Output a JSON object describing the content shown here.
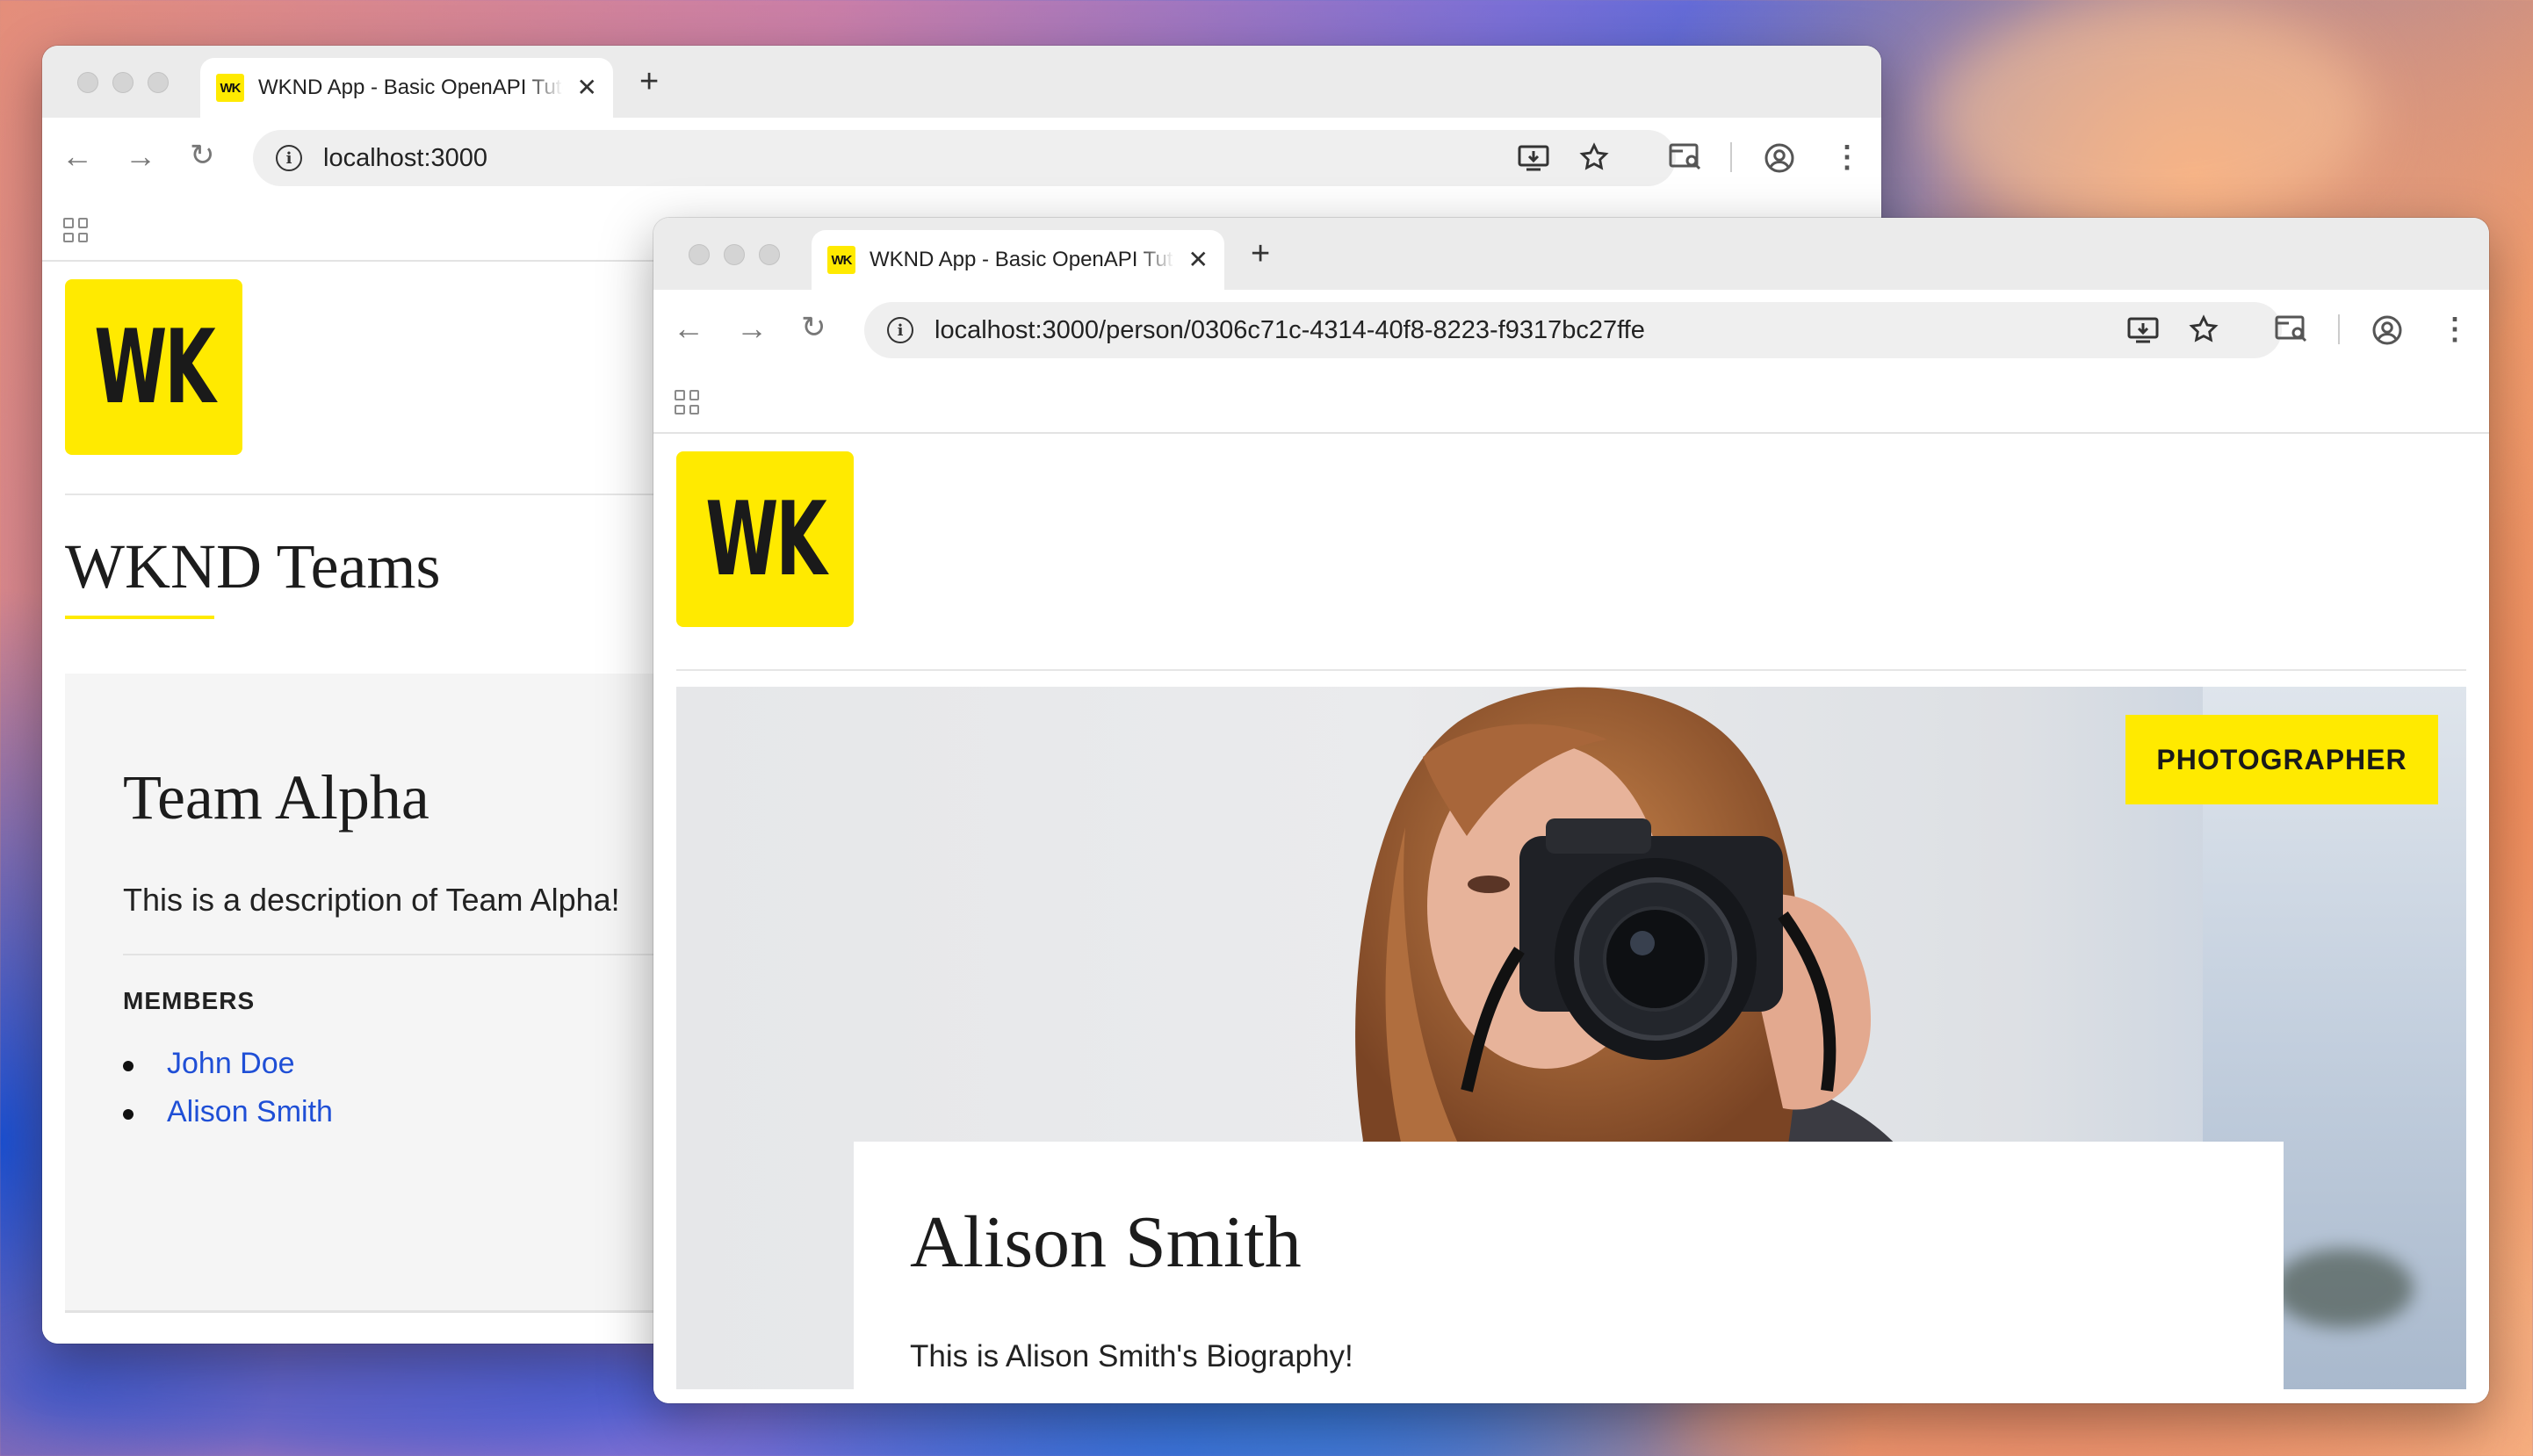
{
  "back_window": {
    "tab": {
      "favicon": "WK",
      "title": "WKND App - Basic OpenAPI Tutorial"
    },
    "url": "localhost:3000",
    "logo": "WK",
    "page_heading": "WKND Teams",
    "team": {
      "name": "Team Alpha",
      "description": "This is a description of Team Alpha!",
      "members_label": "MEMBERS",
      "members": [
        "John Doe",
        "Alison Smith"
      ]
    }
  },
  "front_window": {
    "tab": {
      "favicon": "WK",
      "title": "WKND App - Basic OpenAPI Tutorial"
    },
    "url": "localhost:3000/person/0306c71c-4314-40f8-8223-f9317bc27ffe",
    "logo": "WK",
    "occupation_badge": "PHOTOGRAPHER",
    "person": {
      "name": "Alison Smith",
      "biography": "This is Alison Smith's Biography!"
    }
  },
  "icons": {
    "back": "arrow-left-icon",
    "forward": "arrow-right-icon",
    "reload": "reload-icon",
    "site_info": "info-icon",
    "install": "install-app-icon",
    "bookmark": "star-icon",
    "tab_search": "tab-search-icon",
    "profile": "profile-icon",
    "menu": "kebab-menu-icon",
    "apps": "apps-grid-icon",
    "new_tab": "plus-icon",
    "close_tab": "close-icon"
  },
  "colors": {
    "brand_yellow": "#ffea00",
    "link_blue": "#1f4fd6"
  }
}
